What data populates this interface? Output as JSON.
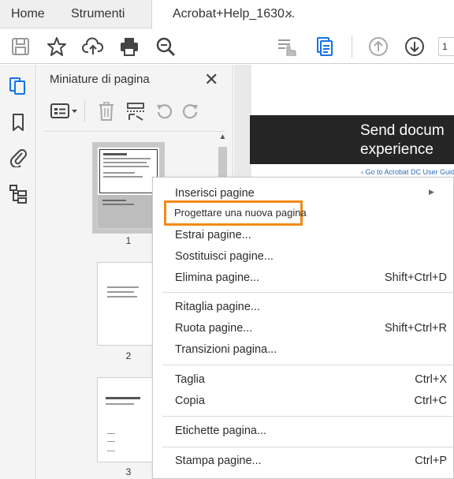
{
  "tabs": [
    {
      "label": "Home"
    },
    {
      "label": "Strumenti"
    },
    {
      "label": "Acrobat+Help_1630...",
      "close": "✕"
    }
  ],
  "toolbar": {
    "page_number": "1"
  },
  "panel": {
    "title": "Miniature di pagina",
    "close": "✕",
    "scroll_up": "▲",
    "thumbnails": [
      {
        "number": "1"
      },
      {
        "number": "2"
      },
      {
        "number": "3"
      }
    ]
  },
  "document": {
    "banner_text": "Send docum\nexperience",
    "link_text": "Go to Acrobat DC User Guid"
  },
  "context_menu": {
    "highlighted_item": "Progettare una nuova pagina",
    "items": [
      {
        "label": "Inserisci pagine",
        "shortcut": "",
        "submenu": "▶"
      },
      {
        "label": "Estrai pagine...",
        "shortcut": ""
      },
      {
        "label": "Sostituisci pagine...",
        "shortcut": ""
      },
      {
        "label": "Elimina pagine...",
        "shortcut": "Shift+Ctrl+D"
      },
      {
        "label": "Ritaglia pagine...",
        "shortcut": ""
      },
      {
        "label": "Ruota pagine...",
        "shortcut": "Shift+Ctrl+R"
      },
      {
        "label": "Transizioni pagina...",
        "shortcut": ""
      },
      {
        "label": "Taglia",
        "shortcut": "Ctrl+X"
      },
      {
        "label": "Copia",
        "shortcut": "Ctrl+C"
      },
      {
        "label": "Etichette pagina...",
        "shortcut": ""
      },
      {
        "label": "Stampa pagine...",
        "shortcut": "Ctrl+P"
      }
    ]
  },
  "colors": {
    "highlight_border": "#f28a16",
    "accent_blue": "#1473e6",
    "banner_bg": "#252525"
  }
}
